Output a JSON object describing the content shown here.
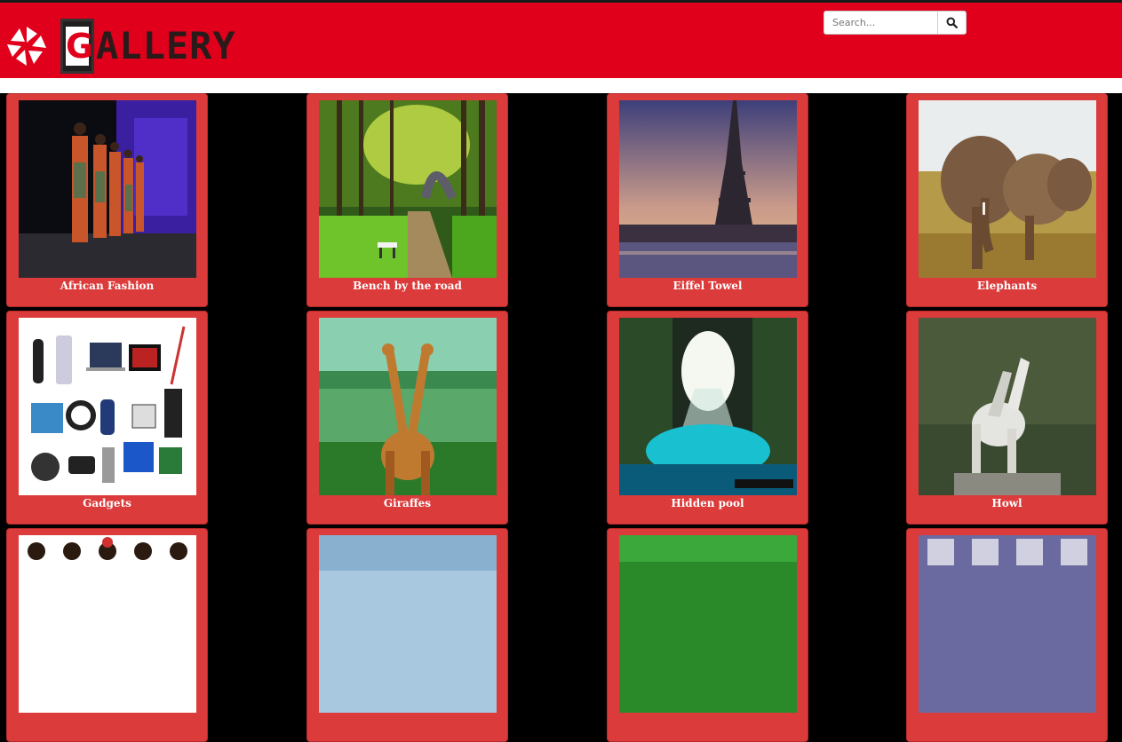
{
  "header": {
    "logo_letter": "G",
    "logo_rest": "ALLERY",
    "search": {
      "placeholder": "Search..."
    },
    "search_button_icon": "search-icon",
    "brand_color": "#e0001c",
    "card_color": "#db3b3b"
  },
  "gallery": {
    "items": [
      {
        "caption": "African Fashion"
      },
      {
        "caption": "Bench by the road"
      },
      {
        "caption": "Eiffel Towel"
      },
      {
        "caption": "Elephants"
      },
      {
        "caption": "Gadgets"
      },
      {
        "caption": "Giraffes"
      },
      {
        "caption": "Hidden pool"
      },
      {
        "caption": "Howl"
      },
      {
        "caption": ""
      },
      {
        "caption": ""
      },
      {
        "caption": ""
      },
      {
        "caption": ""
      }
    ]
  }
}
